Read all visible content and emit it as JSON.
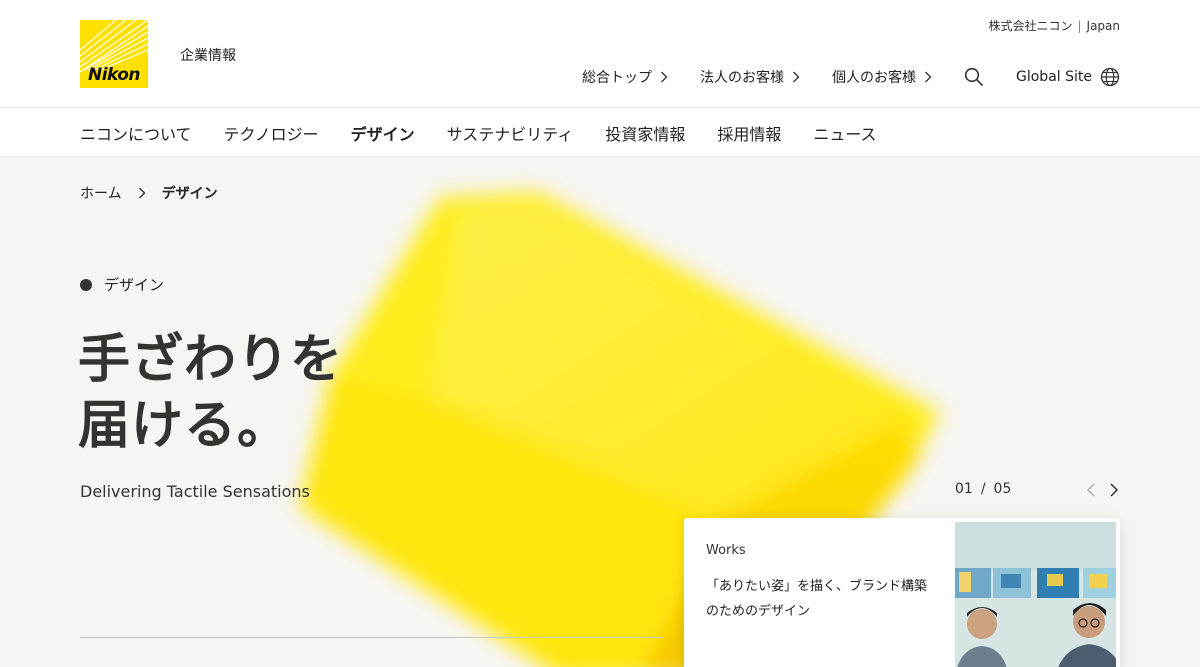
{
  "header": {
    "logo_text": "Nikon",
    "corp_label": "企業情報",
    "lang": {
      "company": "株式会社ニコン",
      "region": "Japan"
    },
    "utility_links": [
      "総合トップ",
      "法人のお客様",
      "個人のお客様"
    ],
    "search_icon": "search-icon",
    "global_site": "Global Site",
    "globe_icon": "globe-icon"
  },
  "nav": {
    "items": [
      "ニコンについて",
      "テクノロジー",
      "デザイン",
      "サステナビリティ",
      "投資家情報",
      "採用情報",
      "ニュース"
    ],
    "active": "デザイン"
  },
  "breadcrumb": {
    "home": "ホーム",
    "current": "デザイン"
  },
  "hero": {
    "section_label": "デザイン",
    "headline_line1": "手ざわりを",
    "headline_line2": "届ける。",
    "subline": "Delivering Tactile Sensations"
  },
  "slider": {
    "current": "01",
    "total": "05"
  },
  "card": {
    "category": "Works",
    "title": "「ありたい姿」を描く、ブランド構築のためのデザイン"
  },
  "colors": {
    "brand_yellow": "#ffe100",
    "text": "#222222",
    "background": "#f6f5f2"
  }
}
